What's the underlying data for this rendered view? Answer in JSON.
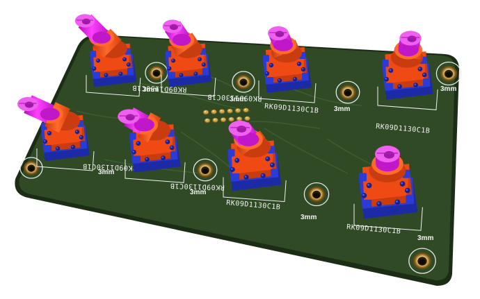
{
  "viewer": {
    "board_color": "#2f4a25",
    "board_edge_color": "#1b2d15",
    "trace_color": "#3e6132",
    "silk_color": "#f2f2f2",
    "pad_gold": "#d4a94a"
  },
  "component": {
    "part_label": "RK09D1130C1B",
    "body_blue": "#2a3bd6",
    "body_orange": "#f04a14",
    "shaft_magenta": "#e020e0"
  },
  "potentiometers": [
    {
      "label": "RK09D1130C1B"
    },
    {
      "label": "RK09D1130C1B"
    },
    {
      "label": "RK09D1130C1B"
    },
    {
      "label": "RK09D1130C1B"
    },
    {
      "label": "RK09D1130C1B"
    },
    {
      "label": "RK09D1130C1B"
    },
    {
      "label": "RK09D1130C1B"
    },
    {
      "label": "RK09D1130C1B"
    }
  ],
  "mounting_holes": [
    {
      "label": "3mm"
    },
    {
      "label": "3mm"
    },
    {
      "label": "3mm"
    },
    {
      "label": "3mm"
    },
    {
      "label": "3mm"
    },
    {
      "label": "3mm"
    },
    {
      "label": "3mm"
    },
    {
      "label": "3mm"
    }
  ]
}
